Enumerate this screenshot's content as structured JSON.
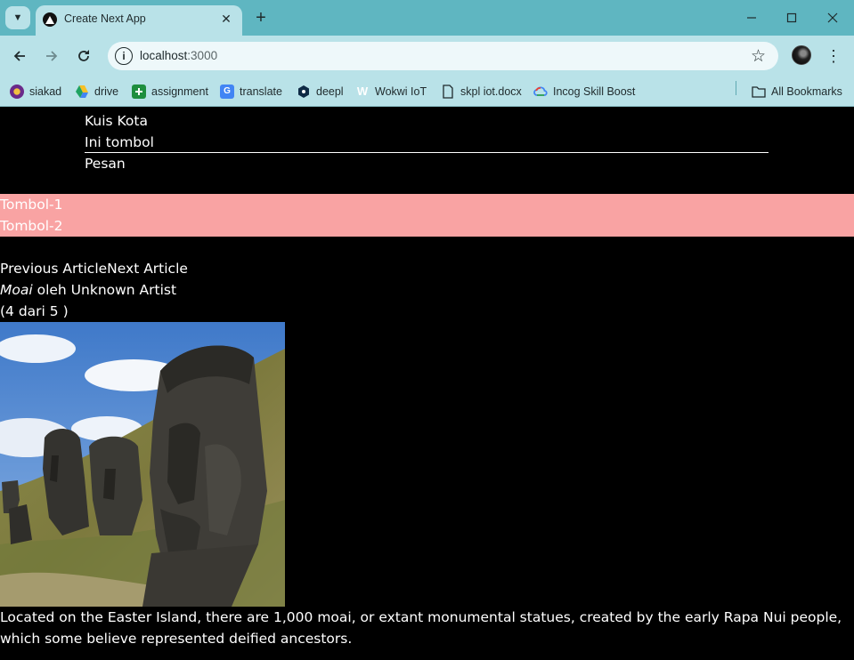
{
  "browser": {
    "tab_title": "Create Next App",
    "url_host": "localhost",
    "url_port": ":3000",
    "bookmarks": [
      {
        "label": "siakad",
        "icon": "university-seal-icon"
      },
      {
        "label": "drive",
        "icon": "google-drive-icon"
      },
      {
        "label": "assignment",
        "icon": "google-classroom-icon"
      },
      {
        "label": "translate",
        "icon": "google-translate-icon"
      },
      {
        "label": "deepl",
        "icon": "deepl-icon"
      },
      {
        "label": "Wokwi IoT",
        "icon": "wokwi-icon"
      },
      {
        "label": "skpl iot.docx",
        "icon": "document-icon"
      },
      {
        "label": "Incog Skill Boost",
        "icon": "google-cloud-icon"
      }
    ],
    "all_bookmarks": "All Bookmarks"
  },
  "page": {
    "quiz": {
      "title": "Kuis Kota",
      "button": "Ini tombol",
      "message": "Pesan"
    },
    "buttons": [
      "Tombol-1",
      "Tombol-2"
    ],
    "gallery": {
      "prev": "Previous Article",
      "next": "Next Article",
      "art_name": "Moai",
      "by": " oleh Unknown Artist",
      "counter": "(4 dari 5 )",
      "description": "Located on the Easter Island, there are 1,000 moai, or extant monumental statues, created by the early Rapa Nui people, which some believe represented deified ancestors."
    }
  },
  "colors": {
    "tabstrip": "#5fb6c1",
    "toolbar": "#b9e2e8",
    "page_bg": "#000000",
    "pink_bar": "#f9a3a3"
  }
}
